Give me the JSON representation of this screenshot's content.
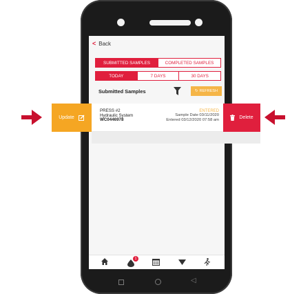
{
  "header": {
    "back_label": "Back"
  },
  "tabs_primary": {
    "submitted": "SUBMITTED SAMPLES",
    "completed": "COMPLETED SAMPLES"
  },
  "tabs_range": {
    "today": "TODAY",
    "seven": "7 DAYS",
    "thirty": "30 DAYS"
  },
  "section": {
    "title": "Submitted Samples",
    "refresh": "REFRESH"
  },
  "swipe": {
    "update": "Update",
    "delete": "Delete"
  },
  "sample": {
    "name": "PRESS #2",
    "system": "Hydraulic System",
    "id": "WC0446978",
    "status": "ENTERED",
    "sample_date": "Sample Date 03/11/2020",
    "entered": "Entered 03/12/2020 07:58 am"
  },
  "tabbar": {
    "alerts_count": "1"
  },
  "colors": {
    "accent": "#e01f3d",
    "warning": "#f5a623",
    "refresh": "#f5b547"
  }
}
